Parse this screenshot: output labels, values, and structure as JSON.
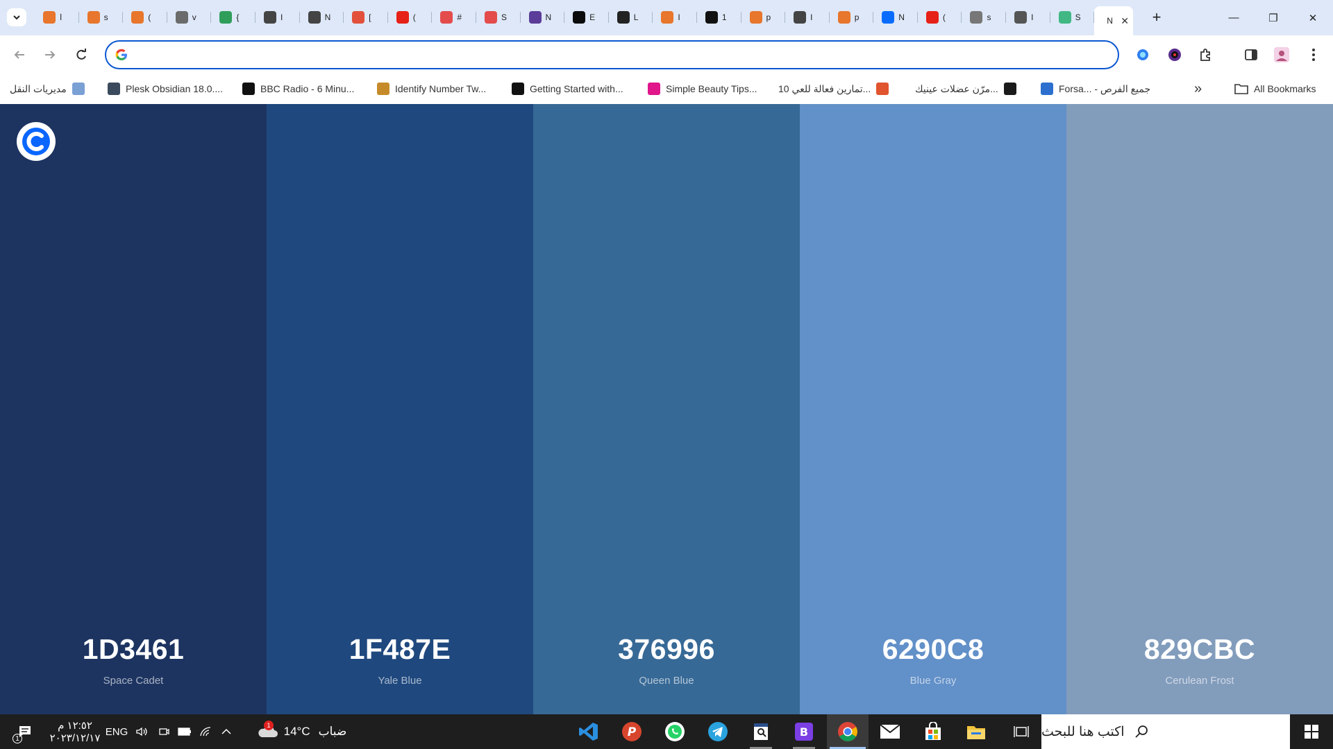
{
  "tabs": [
    {
      "title": "ا",
      "icon": "fire-icon",
      "color": "#e8762c"
    },
    {
      "title": "s",
      "icon": "fire-icon",
      "color": "#e8762c"
    },
    {
      "title": "(",
      "icon": "fire-icon",
      "color": "#e8762c"
    },
    {
      "title": "v",
      "icon": "user-avatar-icon",
      "color": "#6b6b6b"
    },
    {
      "title": "{",
      "icon": "code-bracket-icon",
      "color": "#2f9e5b"
    },
    {
      "title": "I",
      "icon": "openai-icon",
      "color": "#444444"
    },
    {
      "title": "N",
      "icon": "openai-icon",
      "color": "#444444"
    },
    {
      "title": "[",
      "icon": "document-icon",
      "color": "#e2503c"
    },
    {
      "title": "(",
      "icon": "youtube-icon",
      "color": "#e62117"
    },
    {
      "title": "#",
      "icon": "record-icon",
      "color": "#e44c4c"
    },
    {
      "title": "S",
      "icon": "record-icon",
      "color": "#e44c4c"
    },
    {
      "title": "N",
      "icon": "woo-icon",
      "color": "#5b3c99"
    },
    {
      "title": "E",
      "icon": "dev-icon",
      "color": "#0b0b0b"
    },
    {
      "title": "L",
      "icon": "x-circle-icon",
      "color": "#222222"
    },
    {
      "title": "I",
      "icon": "fire-icon",
      "color": "#e8762c"
    },
    {
      "title": "1",
      "icon": "tt-icon",
      "color": "#111111"
    },
    {
      "title": "p",
      "icon": "fire-icon",
      "color": "#e8762c"
    },
    {
      "title": "I",
      "icon": "openai-icon",
      "color": "#444444"
    },
    {
      "title": "p",
      "icon": "fire-icon",
      "color": "#e8762c"
    },
    {
      "title": "N",
      "icon": "coolors-icon",
      "color": "#0a6cff"
    },
    {
      "title": "(",
      "icon": "youtube-icon",
      "color": "#e62117"
    },
    {
      "title": "s",
      "icon": "gear-icon",
      "color": "#777777"
    },
    {
      "title": "I",
      "icon": "globe-icon",
      "color": "#555555"
    },
    {
      "title": "S",
      "icon": "vue-icon",
      "color": "#41b883"
    }
  ],
  "active_tab": {
    "title": "N",
    "close_icon": "close-icon"
  },
  "window_controls": {
    "minimize": "—",
    "restore": "❐",
    "close": "✕"
  },
  "omnibox": {
    "value": "",
    "placeholder": ""
  },
  "bookmarks": [
    {
      "label": "مديريات النقل",
      "icon": "doc-icon",
      "color": "#7aa0d4",
      "rtl": true
    },
    {
      "label": "Plesk Obsidian 18.0....",
      "icon": "plesk-icon",
      "color": "#3b4a5c",
      "rtl": false
    },
    {
      "label": "BBC Radio - 6 Minu...",
      "icon": "bbc-icon",
      "color": "#111111",
      "rtl": false
    },
    {
      "label": "Identify Number Tw...",
      "icon": "figure-icon",
      "color": "#c58b2a",
      "rtl": false
    },
    {
      "label": "Getting Started with...",
      "icon": "medium-icon",
      "color": "#111111",
      "rtl": false
    },
    {
      "label": "Simple Beauty Tips...",
      "icon": "f-icon",
      "color": "#e0168a",
      "rtl": false
    },
    {
      "label": "10 تمارين فعالة للعي...",
      "icon": "leaf-icon",
      "color": "#e0542e",
      "rtl": true
    },
    {
      "label": "مرّن عضلات عينيك...",
      "icon": "a-icon",
      "color": "#1a1a1a",
      "rtl": true
    },
    {
      "label": "Forsa... - جميع الفرص",
      "icon": "info-icon",
      "color": "#2c6fce",
      "rtl": false
    }
  ],
  "more_bookmarks": "»",
  "all_bookmarks": "All Bookmarks",
  "palette": [
    {
      "hex": "1D3461",
      "name": "Space Cadet",
      "color": "#1D3461"
    },
    {
      "hex": "1F487E",
      "name": "Yale Blue",
      "color": "#1F487E"
    },
    {
      "hex": "376996",
      "name": "Queen Blue",
      "color": "#376996"
    },
    {
      "hex": "6290C8",
      "name": "Blue Gray",
      "color": "#6290C8"
    },
    {
      "hex": "829CBC",
      "name": "Cerulean Frost",
      "color": "#829CBC"
    }
  ],
  "taskbar": {
    "search_placeholder": "اكتب هنا للبحث",
    "weather": {
      "temp": "14°C",
      "condition": "ضباب",
      "badge": "1"
    },
    "time": "١٢:٥٢ م",
    "date": "٢٠٢٣/١٢/١٧",
    "language": "ENG",
    "notification_count": "1",
    "apps": [
      "task-view-icon",
      "file-explorer-icon",
      "store-icon",
      "mail-icon",
      "chrome-icon",
      "bootstrap-icon",
      "notepad-icon",
      "telegram-icon",
      "whatsapp-icon",
      "postman-icon",
      "vscode-icon"
    ]
  }
}
